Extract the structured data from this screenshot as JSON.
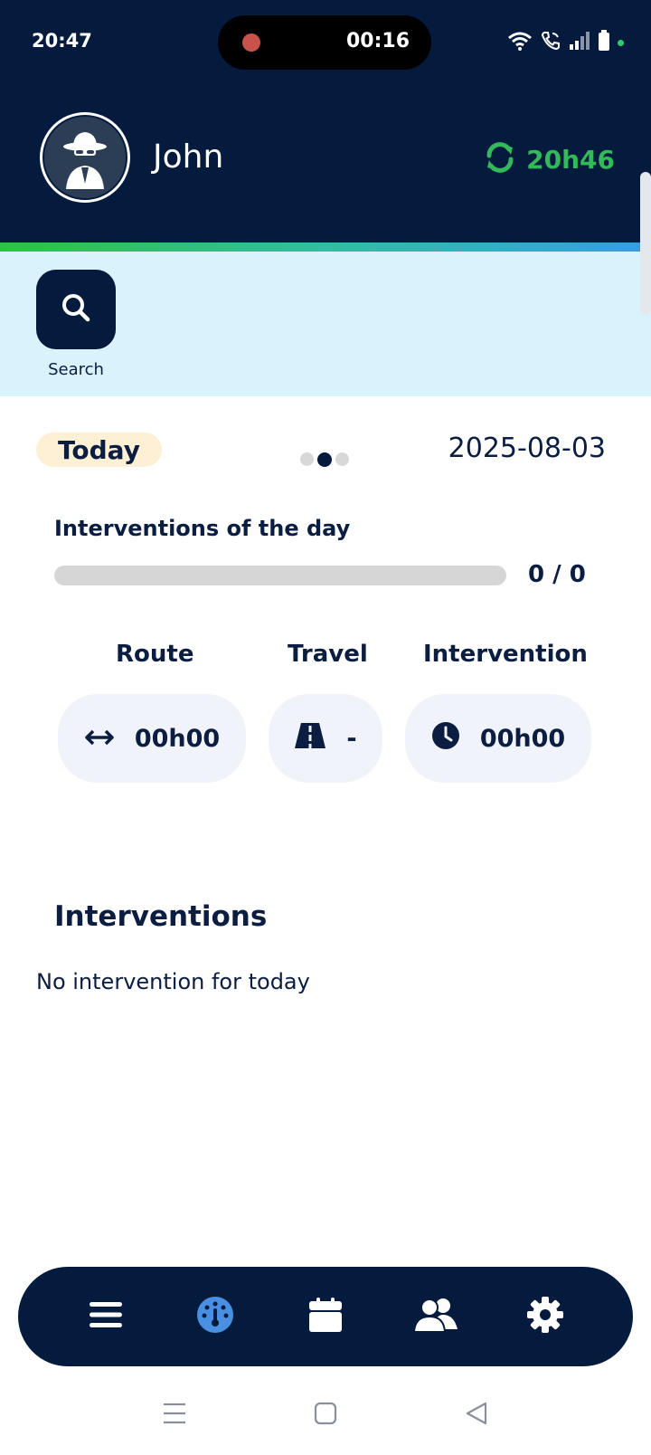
{
  "status_bar": {
    "time": "20:47",
    "recording_time": "00:16",
    "icons": [
      "wifi-icon",
      "wifi-call-icon",
      "signal-icon",
      "battery-icon"
    ]
  },
  "header": {
    "user_name": "John",
    "sync_time": "20h46",
    "sync_icon": "sync-icon",
    "colors": {
      "background": "#041b3e",
      "sync": "#33b85a"
    }
  },
  "search": {
    "label": "Search",
    "icon": "search-icon"
  },
  "day": {
    "badge": "Today",
    "date": "2025-08-03",
    "page_index": 1,
    "page_count": 3
  },
  "interventions_of_day": {
    "title": "Interventions of the day",
    "count_text": "0 / 0",
    "progress": 0
  },
  "stats": [
    {
      "label": "Route",
      "icon": "arrows-horizontal-icon",
      "value": "00h00"
    },
    {
      "label": "Travel",
      "icon": "road-icon",
      "value": "-"
    },
    {
      "label": "Intervention",
      "icon": "clock-icon",
      "value": "00h00"
    }
  ],
  "interventions": {
    "title": "Interventions",
    "empty_message": "No intervention for today"
  },
  "bottom_nav": {
    "items": [
      "menu-icon",
      "dashboard-icon",
      "calendar-icon",
      "users-icon",
      "settings-icon"
    ],
    "active": "dashboard-icon",
    "active_color": "#4a90e2"
  },
  "system_nav": [
    "recent-apps-icon",
    "home-icon",
    "back-icon"
  ]
}
